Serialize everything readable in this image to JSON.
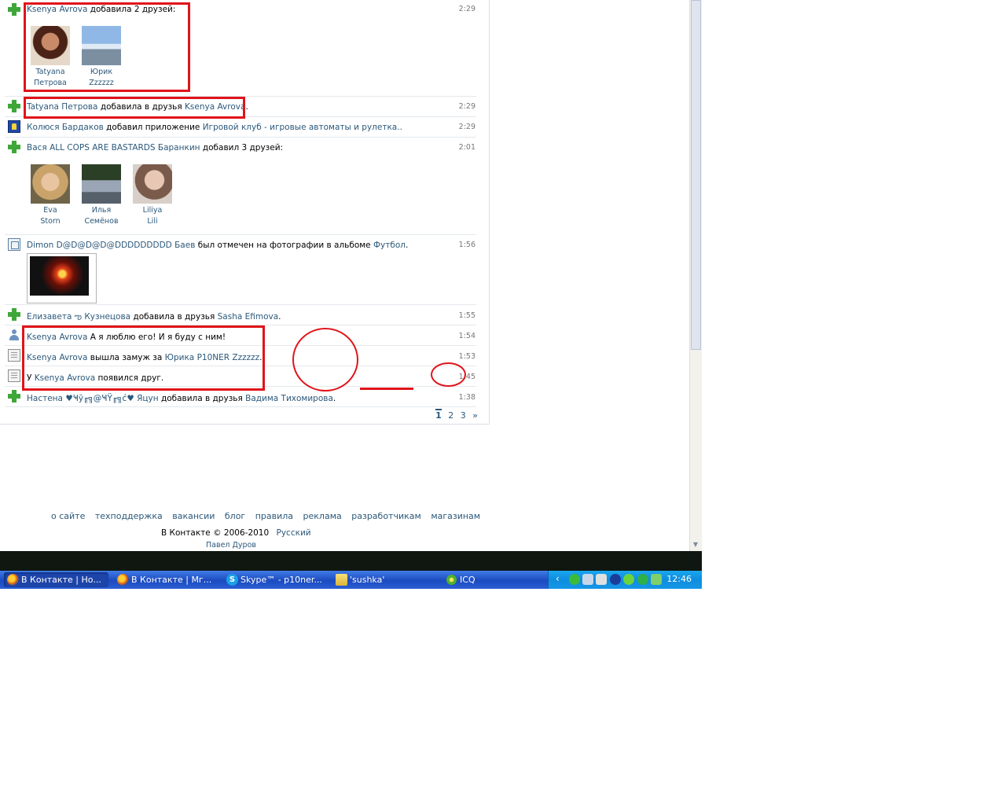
{
  "feed": {
    "items": [
      {
        "name": "Ksenya Avrova",
        "action": "добавила 2 друзей:",
        "time": "2:29",
        "friends": [
          {
            "line1": "Tatyana",
            "line2": "Петрова"
          },
          {
            "line1": "Юрик",
            "line2": "Zzzzzz"
          }
        ]
      },
      {
        "name": "Tatyana Петрова",
        "action": "добавила в друзья",
        "target": "Ksenya Avrova",
        "tail": ".",
        "time": "2:29"
      },
      {
        "name": "Колюся Бардаков",
        "action": "добавил приложение",
        "target": "Игровой клуб - игровые автоматы и рулетка..",
        "tail": "",
        "time": "2:29"
      },
      {
        "name": "Вася ALL COPS ARE BASTARDS Баранкин",
        "action": "добавил 3 друзей:",
        "time": "2:01",
        "friends": [
          {
            "line1": "Eva",
            "line2": "Storn"
          },
          {
            "line1": "Илья",
            "line2": "Семёнов"
          },
          {
            "line1": "Liliya",
            "line2": "Lili"
          }
        ]
      },
      {
        "name": "Dimon D@D@D@D@DDDDDDDDD Баев",
        "action": "был отмечен на фотографии в альбоме",
        "target": "Футбол",
        "tail": ".",
        "time": "1:56"
      },
      {
        "name": "Елизавета ఌ Кузнецова",
        "action": "добавила в друзья",
        "target": "Sasha Efimova",
        "tail": ".",
        "time": "1:55"
      },
      {
        "name": "Ksenya Avrova",
        "action": "А я люблю его! И я буду с ним!",
        "time": "1:54"
      },
      {
        "name": "Ksenya Avrova",
        "action": "вышла замуж за",
        "target": "Юрика P10NER Zzzzzz",
        "tail": ".",
        "time": "1:53"
      },
      {
        "prefix": "У",
        "name": "Ksenya Avrova",
        "action": "появился друг.",
        "time": "1:45"
      },
      {
        "name": "Настена ♥Ҹў╓╗@ҸŸ╓╗ć♥ Яцун",
        "action": "добавила в друзья",
        "target": "Вадима Тихомирова",
        "tail": ".",
        "time": "1:38"
      }
    ],
    "pager": {
      "pages": [
        "1",
        "2",
        "3"
      ],
      "next": "»"
    }
  },
  "footer": {
    "links": [
      "о сайте",
      "техподдержка",
      "вакансии",
      "блог",
      "правила",
      "реклама",
      "разработчикам",
      "магазинам"
    ],
    "copyright": "В Контакте © 2006-2010",
    "language": "Русский",
    "author": "Павел Дуров"
  },
  "taskbar": {
    "tasks": [
      {
        "label": "В Контакте | Но...",
        "icon": "firefox-icon"
      },
      {
        "label": "В Контакте | Мг...",
        "icon": "firefox-icon"
      },
      {
        "label": "Skype™ - p10ner...",
        "icon": "skype-icon"
      },
      {
        "label": "'sushka'",
        "icon": "folder-icon"
      },
      {
        "label": "ICQ",
        "icon": "icq-icon"
      }
    ],
    "clock": "12:46"
  },
  "colors": {
    "link": "#2b587a",
    "annotation": "#e0141a",
    "taskbar": "#2353c6"
  }
}
